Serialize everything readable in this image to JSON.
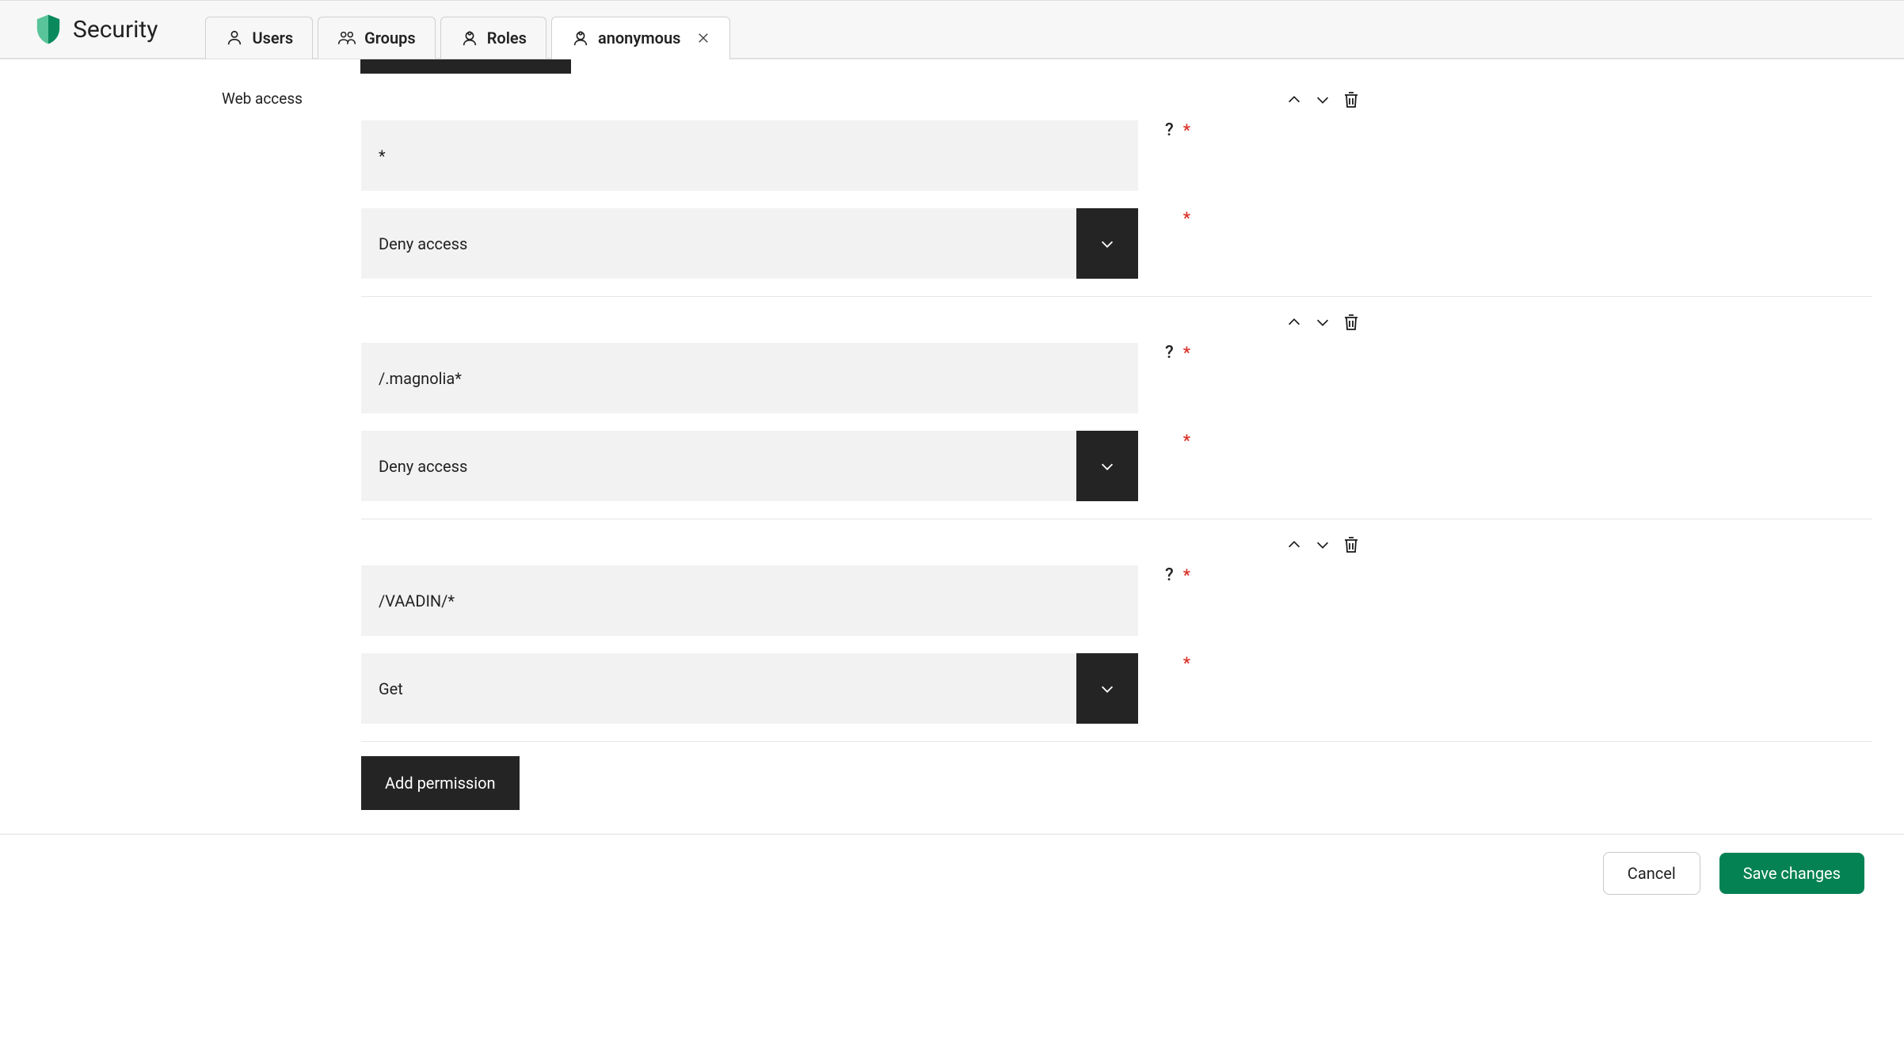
{
  "app": {
    "title": "Security"
  },
  "tabs": {
    "users": "Users",
    "groups": "Groups",
    "roles": "Roles",
    "anonymous": "anonymous"
  },
  "section": {
    "label": "Web access"
  },
  "permissions": [
    {
      "path": "*",
      "access": "Deny access"
    },
    {
      "path": "/.magnolia*",
      "access": "Deny access"
    },
    {
      "path": "/VAADIN/*",
      "access": "Get"
    }
  ],
  "buttons": {
    "add_permission": "Add permission",
    "cancel": "Cancel",
    "save": "Save changes"
  },
  "symbols": {
    "help": "?",
    "required": "*"
  }
}
